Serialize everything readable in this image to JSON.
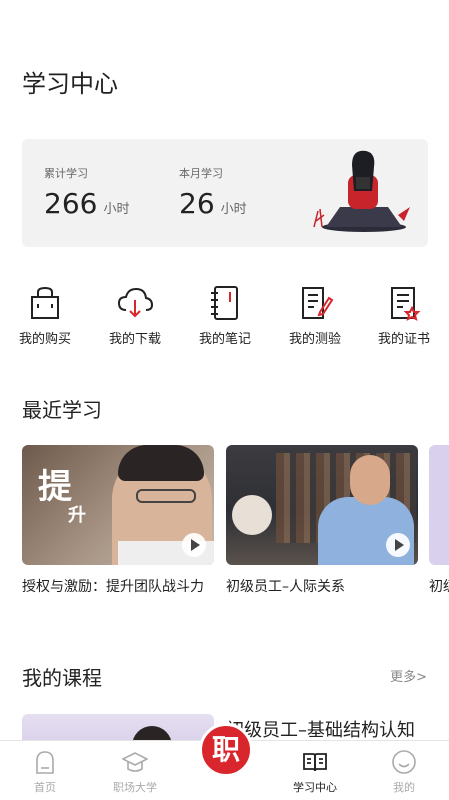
{
  "page": {
    "title": "学习中心"
  },
  "stats": {
    "total_label": "累计学习",
    "total_value": "266",
    "total_unit": "小时",
    "month_label": "本月学习",
    "month_value": "26",
    "month_unit": "小时"
  },
  "quick_actions": [
    {
      "label": "我的购买",
      "icon": "shopping-bag-icon"
    },
    {
      "label": "我的下载",
      "icon": "cloud-download-icon"
    },
    {
      "label": "我的笔记",
      "icon": "notebook-icon"
    },
    {
      "label": "我的测验",
      "icon": "quiz-icon"
    },
    {
      "label": "我的证书",
      "icon": "certificate-icon"
    }
  ],
  "recent": {
    "title": "最近学习",
    "items": [
      {
        "caption": "授权与激励：提升团队战斗力",
        "thumb_text": "提",
        "thumb_text2": "升"
      },
      {
        "caption": "初级员工–人际关系"
      },
      {
        "caption": "初级"
      }
    ]
  },
  "courses": {
    "title": "我的课程",
    "more": "更多>",
    "first_course": "初级员工–基础结构认知"
  },
  "tabs": [
    {
      "label": "首页",
      "icon": "home-icon"
    },
    {
      "label": "职场大学",
      "icon": "graduation-cap-icon"
    },
    {
      "label": "职",
      "icon": "center-logo"
    },
    {
      "label": "学习中心",
      "icon": "open-book-icon",
      "active": true
    },
    {
      "label": "我的",
      "icon": "smile-icon"
    }
  ],
  "colors": {
    "accent": "#d8262c",
    "text": "#222222",
    "muted": "#888888",
    "card_bg": "#f2f2f2"
  }
}
